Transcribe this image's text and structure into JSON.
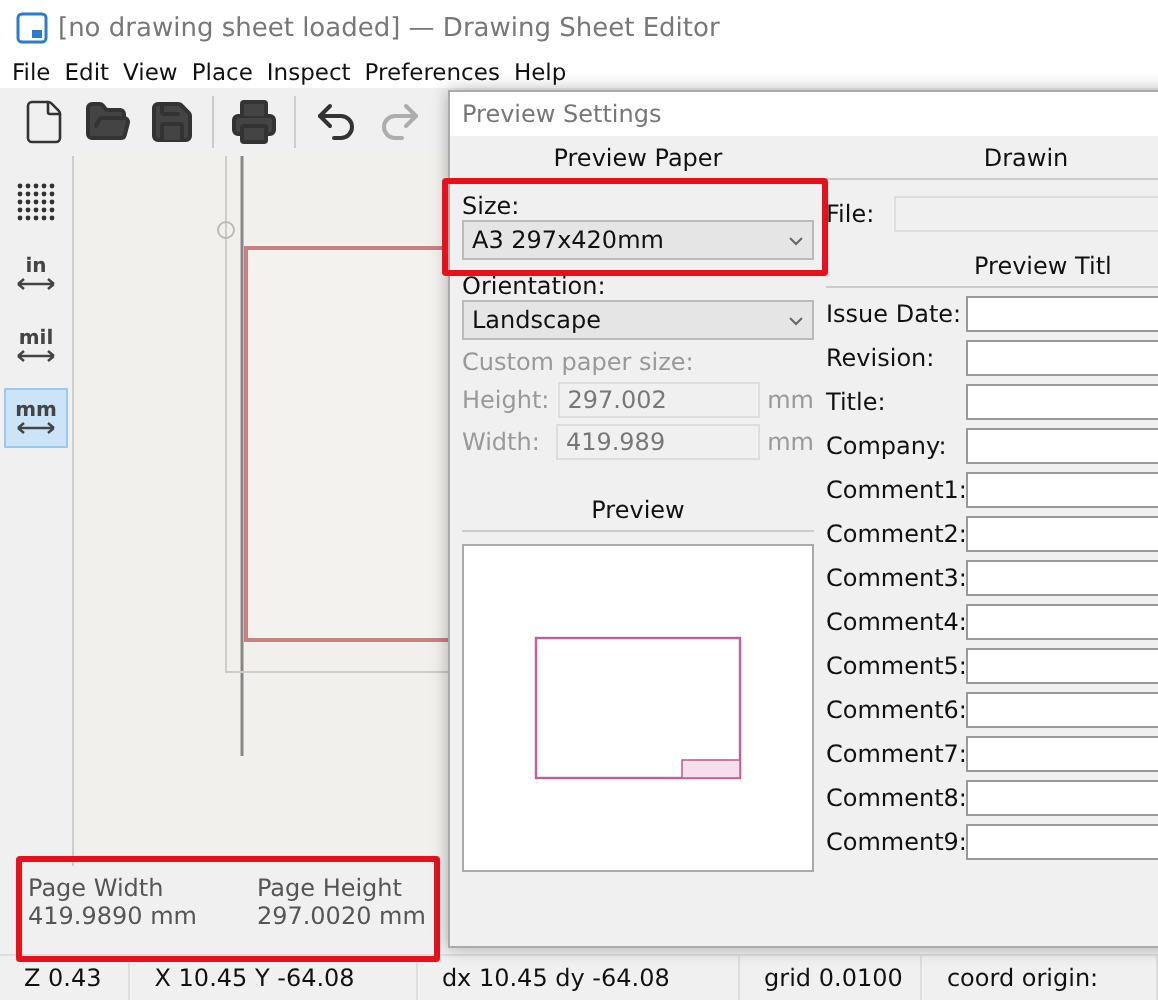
{
  "window": {
    "title": "[no drawing sheet loaded] — Drawing Sheet Editor"
  },
  "menu": [
    "File",
    "Edit",
    "View",
    "Place",
    "Inspect",
    "Preferences",
    "Help"
  ],
  "toolbar": [
    {
      "kind": "new",
      "disabled": false
    },
    {
      "kind": "open",
      "disabled": false
    },
    {
      "kind": "save",
      "disabled": false
    },
    {
      "kind": "separator"
    },
    {
      "kind": "print",
      "disabled": false
    },
    {
      "kind": "separator"
    },
    {
      "kind": "undo",
      "disabled": false
    },
    {
      "kind": "redo",
      "disabled": true
    }
  ],
  "side_toolbar": [
    {
      "kind": "grid",
      "selected": false
    },
    {
      "kind": "unit",
      "label": "in",
      "selected": false
    },
    {
      "kind": "unit",
      "label": "mil",
      "selected": false
    },
    {
      "kind": "unit",
      "label": "mm",
      "selected": true
    }
  ],
  "properties": [
    {
      "label": "Page Width",
      "value": "419.9890 mm"
    },
    {
      "label": "Page Height",
      "value": "297.0020 mm"
    }
  ],
  "status_bar": [
    "Z 0.43",
    "X 10.45  Y -64.08",
    "dx 10.45  dy -64.08",
    "grid 0.0100",
    "coord origin:"
  ],
  "dialog": {
    "title": "Preview Settings",
    "paper": {
      "heading": "Preview Paper",
      "size_label": "Size:",
      "size": "A3 297x420mm",
      "orientation_label": "Orientation:",
      "orientation": "Landscape",
      "custom_label": "Custom paper size:",
      "custom_disabled": true,
      "custom_fields": [
        {
          "label": "Height:",
          "value": "297.002",
          "unit": "mm"
        },
        {
          "label": "Width:",
          "value": "419.989",
          "unit": "mm"
        }
      ],
      "preview_heading": "Preview"
    },
    "drawing": {
      "heading": "Drawin",
      "file_label": "File:",
      "title_heading": "Preview Titl",
      "fields": [
        {
          "label": "Issue Date:"
        },
        {
          "label": "Revision:"
        },
        {
          "label": "Title:"
        },
        {
          "label": "Company:"
        },
        {
          "label": "Comment1:"
        },
        {
          "label": "Comment2:"
        },
        {
          "label": "Comment3:"
        },
        {
          "label": "Comment4:"
        },
        {
          "label": "Comment5:"
        },
        {
          "label": "Comment6:"
        },
        {
          "label": "Comment7:"
        },
        {
          "label": "Comment8:"
        },
        {
          "label": "Comment9:"
        }
      ]
    }
  }
}
